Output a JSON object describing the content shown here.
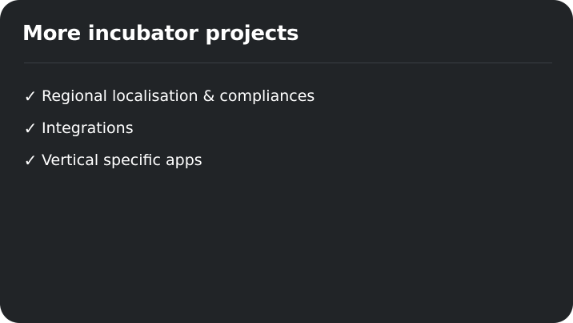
{
  "card": {
    "title": "More incubator projects",
    "items": [
      {
        "icon": "checkmark-icon",
        "glyph": "✓",
        "label": "Regional localisation & compliances"
      },
      {
        "icon": "checkmark-icon",
        "glyph": "✓",
        "label": "Integrations"
      },
      {
        "icon": "checkmark-icon",
        "glyph": "✓",
        "label": "Vertical specific apps"
      }
    ]
  },
  "colors": {
    "card_background": "#212427",
    "text": "#ffffff",
    "divider": "#3b3f44",
    "page_background": "#ffffff"
  }
}
